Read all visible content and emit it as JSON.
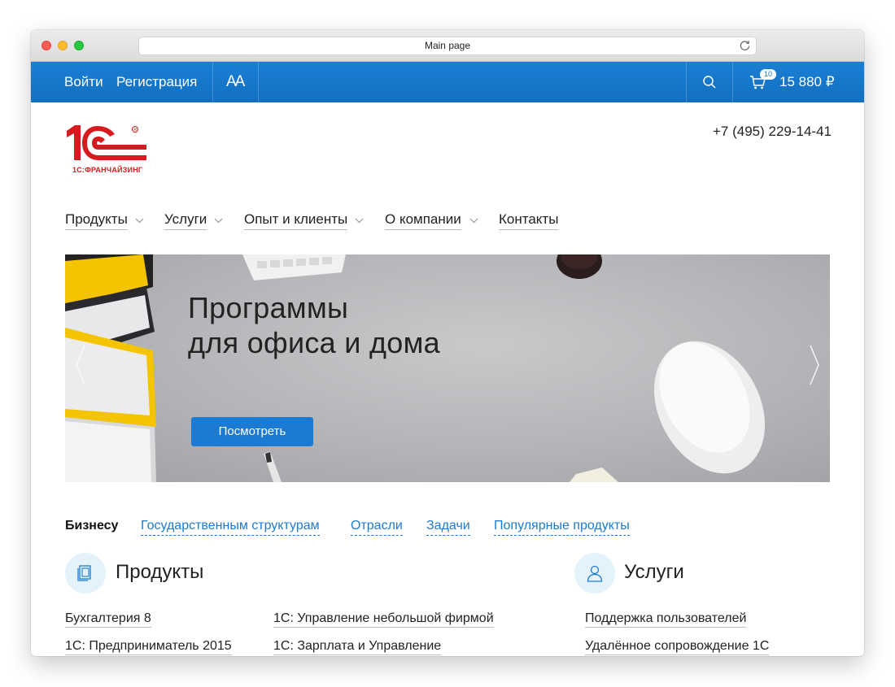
{
  "browser": {
    "url_title": "Main page"
  },
  "topbar": {
    "login": "Войти",
    "register": "Регистрация",
    "font_size_label": "AA",
    "cart_count": "10",
    "cart_total": "15 880 ₽"
  },
  "header": {
    "logo_text": "1С:ФРАНЧАЙЗИНГ",
    "phone": "+7 (495) 229-14-41"
  },
  "nav": {
    "items": [
      {
        "label": "Продукты",
        "has_dropdown": true
      },
      {
        "label": "Услуги",
        "has_dropdown": true
      },
      {
        "label": "Опыт и клиенты",
        "has_dropdown": true
      },
      {
        "label": "О компании",
        "has_dropdown": true
      },
      {
        "label": "Контакты",
        "has_dropdown": false
      }
    ]
  },
  "banner": {
    "title_line1": "Программы",
    "title_line2": "для офиса и дома",
    "button": "Посмотреть"
  },
  "tabs": {
    "items": [
      {
        "label": "Бизнесу",
        "active": true
      },
      {
        "label": "Государственным структурам",
        "active": false
      },
      {
        "label": "Отрасли",
        "active": false
      },
      {
        "label": "Задачи",
        "active": false
      },
      {
        "label": "Популярные продукты",
        "active": false
      }
    ]
  },
  "products": {
    "title": "Продукты",
    "links": [
      "Бухгалтерия 8",
      "1С: Управление небольшой фирмой",
      "1С: Предприниматель 2015",
      "1С: Зарплата и Управление"
    ]
  },
  "services": {
    "title": "Услуги",
    "links": [
      "Поддержка пользователей",
      "Удалённое сопровождение 1С"
    ]
  },
  "colors": {
    "brand_blue": "#1b7bd2",
    "logo_red": "#d71920"
  }
}
